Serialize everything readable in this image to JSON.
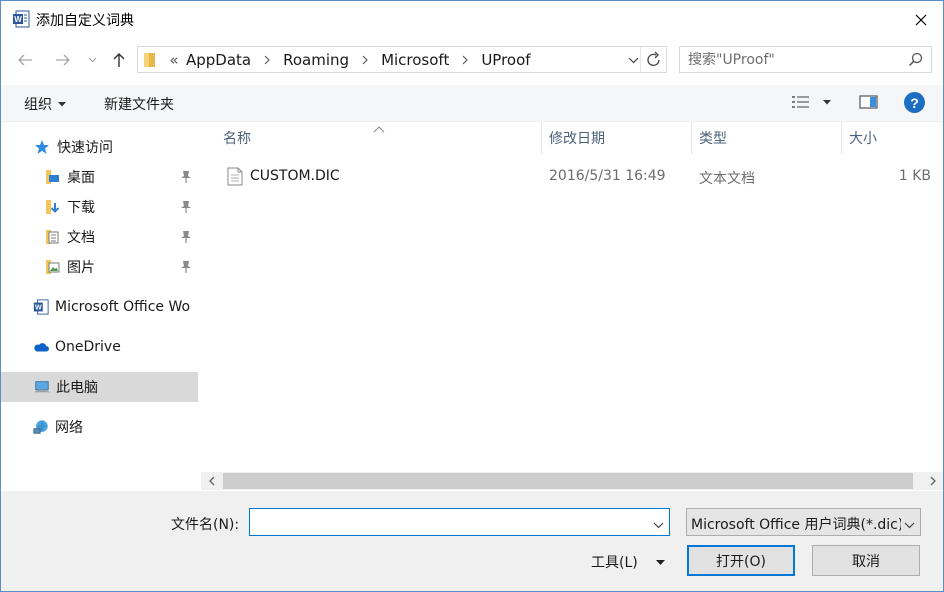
{
  "window": {
    "title": "添加自定义词典"
  },
  "address": {
    "overflow": "«",
    "crumbs": [
      "AppData",
      "Roaming",
      "Microsoft",
      "UProof"
    ]
  },
  "search": {
    "placeholder": "搜索\"UProof\""
  },
  "toolbar": {
    "organize": "组织",
    "new_folder": "新建文件夹"
  },
  "navpane": {
    "items": [
      {
        "label": "快速访问",
        "icon": "star-icon"
      },
      {
        "label": "桌面",
        "icon": "desktop-folder-icon",
        "pinned": true
      },
      {
        "label": "下载",
        "icon": "download-folder-icon",
        "pinned": true
      },
      {
        "label": "文档",
        "icon": "documents-folder-icon",
        "pinned": true
      },
      {
        "label": "图片",
        "icon": "pictures-folder-icon",
        "pinned": true
      },
      {
        "label": "Microsoft Office Wo",
        "icon": "word-icon"
      },
      {
        "label": "OneDrive",
        "icon": "onedrive-cloud-icon"
      },
      {
        "label": "此电脑",
        "icon": "computer-icon",
        "selected": true
      },
      {
        "label": "网络",
        "icon": "network-icon"
      }
    ]
  },
  "filelist": {
    "columns": {
      "name": "名称",
      "date": "修改日期",
      "type": "类型",
      "size": "大小"
    },
    "files": [
      {
        "name": "CUSTOM.DIC",
        "date": "2016/5/31 16:49",
        "type": "文本文档",
        "size": "1 KB"
      }
    ]
  },
  "bottom": {
    "filename_label": "文件名(N):",
    "filename_value": "",
    "filetype_value": "Microsoft Office 用户词典(*.dic)",
    "tools_label": "工具(L)",
    "open_button": "打开(O)",
    "cancel_button": "取消"
  },
  "colors": {
    "accent": "#0078d7",
    "help": "#1b6ec2",
    "selected": "#d9d9d9"
  }
}
